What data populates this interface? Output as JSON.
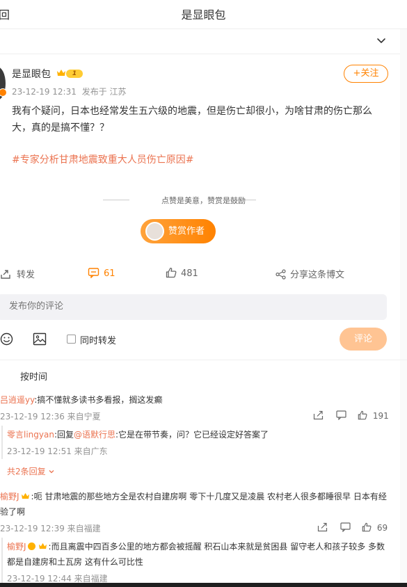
{
  "header": {
    "back_label": "回",
    "title": "是显眼包"
  },
  "post": {
    "author": "是显眼包",
    "level": "1",
    "timestamp": "23-12-19 12:31",
    "source": "发布于 江苏",
    "follow_label": "+关注",
    "text": "我有个疑问，日本也经常发生五六级的地震，但是伤亡却很小，为啥甘肃的伤亡那么大，真的是搞不懂？？",
    "topic": "#专家分析甘肃地震致重大人员伤亡原因#"
  },
  "reward": {
    "tagline": "点赞是美意，赞赏是鼓励",
    "button_label": "赞赏作者"
  },
  "actions": {
    "repost_label": "转发",
    "comment_count": "61",
    "like_count": "481",
    "share_label": "分享这条博文"
  },
  "composer": {
    "placeholder": "发布你的评论",
    "repost_checkbox_label": "同时转发",
    "submit_label": "评论"
  },
  "sort_label": "按时间",
  "comments": [
    {
      "user": "吕逍遥yy",
      "text": ":搞不懂就多读书多看报，搁这发癫",
      "meta": "23-12-19 12:36 来自宁夏",
      "likes": "191",
      "reply": {
        "user": "零言lingyan",
        "prefix": ":回复",
        "mention": "@语默行思",
        "text": ":它是在带节奏，问？它已经设定好答案了",
        "meta": "23-12-19 12:51 来自广东"
      },
      "more_replies": "共2条回复"
    },
    {
      "user": "榆野J",
      "text": ":呃 甘肃地震的那些地方全是农村自建房啊 零下十几度又是凌晨 农村老人很多都睡很早 日本有经验了啊",
      "meta": "23-12-19 12:39 来自福建",
      "likes": "69",
      "reply": {
        "user": "榆野J",
        "text": ":而且离震中四百多公里的地方都会被摇醒 积石山本来就是贫困县 留守老人和孩子较多 多数都是自建房和土瓦房 这有什么可比性",
        "meta": "23-12-19 12:44 来自福建"
      }
    }
  ]
}
